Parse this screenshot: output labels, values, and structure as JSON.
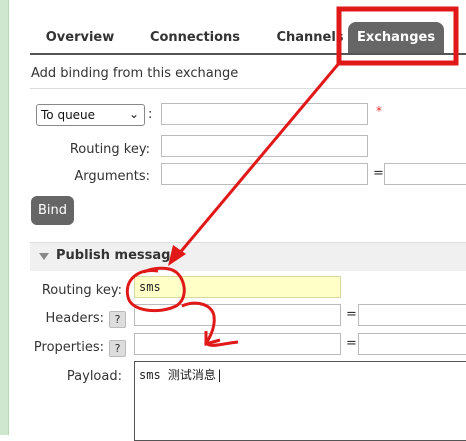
{
  "tabs": [
    {
      "label": "Overview"
    },
    {
      "label": "Connections"
    },
    {
      "label": "Channels"
    },
    {
      "label": "Exchanges"
    }
  ],
  "binding": {
    "section_title": "Add binding from this exchange",
    "destination_type": "To queue",
    "colon": ":",
    "required_mark": "*",
    "routing_key_label": "Routing key:",
    "arguments_label": "Arguments:",
    "equals": "=",
    "bind_button": "Bind"
  },
  "publish": {
    "title": "Publish message",
    "routing_key_label": "Routing key:",
    "routing_key_value": "sms",
    "headers_label": "Headers:",
    "properties_label": "Properties:",
    "help_mark": "?",
    "equals": "=",
    "payload_label": "Payload:",
    "payload_value": "sms 测试消息|"
  },
  "annotation_color": "#e01818"
}
